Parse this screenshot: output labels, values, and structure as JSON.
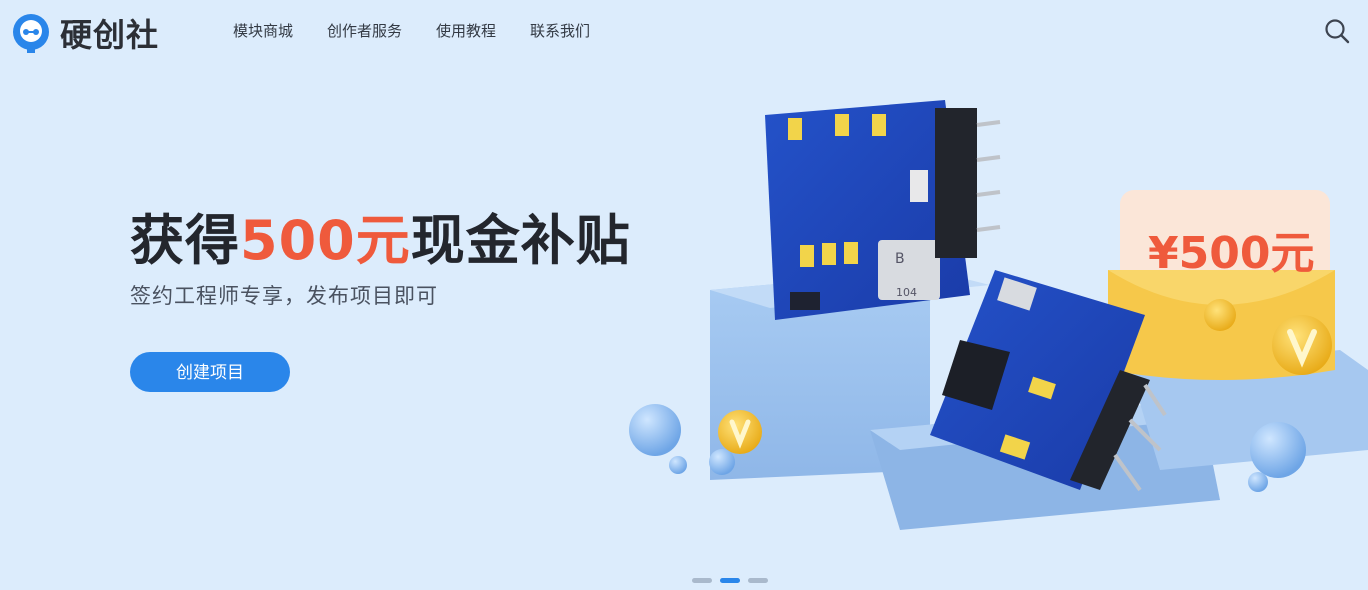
{
  "header": {
    "logo_text": "硬创社",
    "nav": [
      {
        "label": "模块商城"
      },
      {
        "label": "创作者服务"
      },
      {
        "label": "使用教程"
      },
      {
        "label": "联系我们"
      }
    ]
  },
  "hero": {
    "title_prefix": "获得",
    "title_accent": "500元",
    "title_suffix": "现金补贴",
    "subtitle": "签约工程师专享，发布项目即可",
    "cta_label": "创建项目",
    "envelope_text": "¥500元",
    "chip_marking_b": "B",
    "chip_marking_104": "104"
  },
  "colors": {
    "accent": "#ef5a3c",
    "primary": "#2a86ea",
    "background": "#dcecfc"
  },
  "carousel": {
    "active_index": 1,
    "count": 3
  }
}
